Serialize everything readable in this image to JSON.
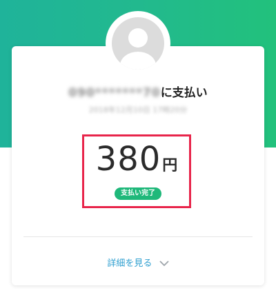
{
  "payment": {
    "payee_masked": "090*******70",
    "payee_suffix": "に支払い",
    "datetime": "2018年12月10日 17時20分",
    "amount": "380",
    "currency": "円",
    "status": "支払い完了"
  },
  "actions": {
    "details_label": "詳細を見る"
  },
  "icons": {
    "avatar": "default-user-avatar-icon",
    "chevron": "chevron-down-icon"
  },
  "colors": {
    "header_gradient_start": "#1fb39a",
    "header_gradient_end": "#22c17c",
    "status_badge": "#1fb87a",
    "highlight_border": "#e8254b",
    "link": "#2f9fd0"
  }
}
